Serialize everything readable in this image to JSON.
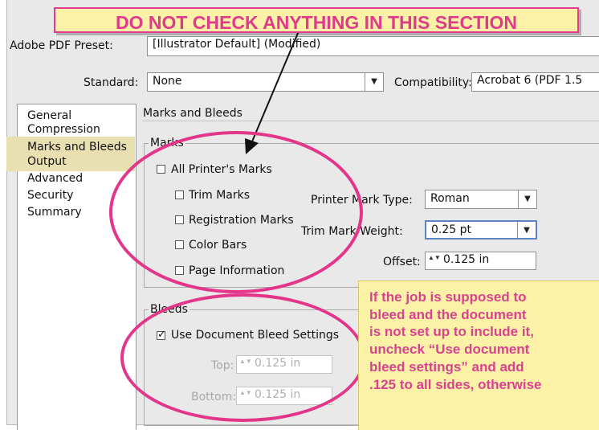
{
  "banner": {
    "text": "DO NOT CHECK ANYTHING IN THIS SECTION"
  },
  "preset": {
    "label": "Adobe PDF Preset:",
    "value": "[Illustrator Default] (Modified)"
  },
  "standard": {
    "label": "Standard:",
    "value": "None"
  },
  "compatibility": {
    "label": "Compatibility:",
    "value": "Acrobat 6 (PDF 1.5"
  },
  "sidebar": {
    "items": [
      {
        "label": "General"
      },
      {
        "label": "Compression"
      },
      {
        "label": "Marks and Bleeds",
        "selected": true
      },
      {
        "label": "Output"
      },
      {
        "label": "Advanced"
      },
      {
        "label": "Security"
      },
      {
        "label": "Summary"
      }
    ]
  },
  "section": {
    "title": "Marks and Bleeds"
  },
  "marks": {
    "group_title": "Marks",
    "all_printers_marks": {
      "label": "All Printer's Marks",
      "checked": false
    },
    "trim_marks": {
      "label": "Trim Marks",
      "checked": false
    },
    "registration_marks": {
      "label": "Registration Marks",
      "checked": false
    },
    "color_bars": {
      "label": "Color Bars",
      "checked": false
    },
    "page_information": {
      "label": "Page Information",
      "checked": false
    },
    "printer_mark_type": {
      "label": "Printer Mark Type:",
      "value": "Roman"
    },
    "trim_mark_weight": {
      "label": "Trim Mark Weight:",
      "value": "0.25 pt"
    },
    "offset": {
      "label": "Offset:",
      "value": "0.125 in"
    }
  },
  "bleeds": {
    "group_title": "Bleeds",
    "use_document_bleed": {
      "label": "Use Document Bleed Settings",
      "checked": true,
      "check_glyph": "✓"
    },
    "top": {
      "label": "Top:",
      "value": "0.125 in"
    },
    "bottom": {
      "label": "Bottom:",
      "value": "0.125 in"
    }
  },
  "note": {
    "lines": [
      "If the job is supposed to",
      "bleed and the document",
      "is not set up to include it,",
      "uncheck “Use document",
      "bleed settings” and add",
      ".125 to all sides, otherwise"
    ]
  },
  "icons": {
    "dropdown": "▼",
    "stepper": "▲▼"
  },
  "colors": {
    "annotation_pink": "#e3368a",
    "note_yellow": "#fbf2a7",
    "dialog_bg": "#e9e9e9",
    "selection": "#e8e0b0"
  }
}
